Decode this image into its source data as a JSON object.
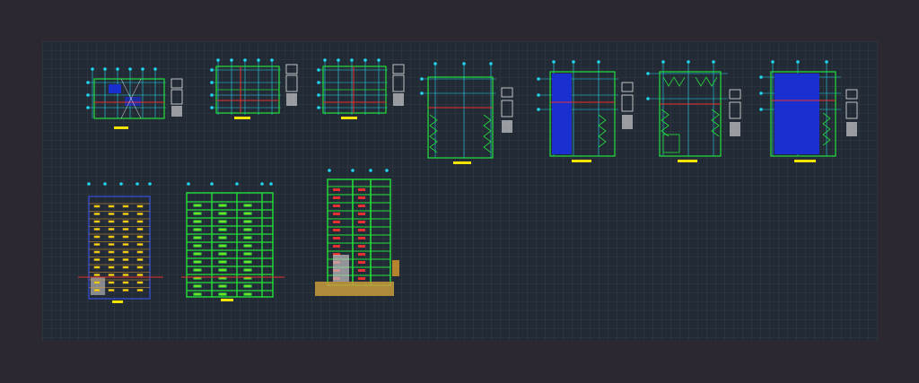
{
  "app": {
    "canvas_background": "#2c2832",
    "viewport_background": "#222b35"
  },
  "colors": {
    "wall_green": "#22e03a",
    "axis_cyan": "#22d3ee",
    "dim_blue": "#3c55ff",
    "fill_blue": "#1a2fd0",
    "section_red": "#e83030",
    "title_yellow": "#f2e400",
    "note_white": "#e8e8e8"
  },
  "drawing": {
    "floor_plans": [
      {
        "id": "plan-1",
        "kind": "ground-floor-plan"
      },
      {
        "id": "plan-2",
        "kind": "typical-floor-plan"
      },
      {
        "id": "plan-3",
        "kind": "typical-floor-plan"
      },
      {
        "id": "plan-4",
        "kind": "floor-plan-with-bracing"
      },
      {
        "id": "plan-5",
        "kind": "floor-plan-filled"
      },
      {
        "id": "plan-6",
        "kind": "floor-plan-with-bracing"
      },
      {
        "id": "plan-7",
        "kind": "floor-plan-filled"
      }
    ],
    "elevations": [
      {
        "id": "elevation-1",
        "kind": "front-elevation"
      },
      {
        "id": "elevation-2",
        "kind": "side-elevation"
      },
      {
        "id": "section-1",
        "kind": "building-section"
      }
    ]
  }
}
